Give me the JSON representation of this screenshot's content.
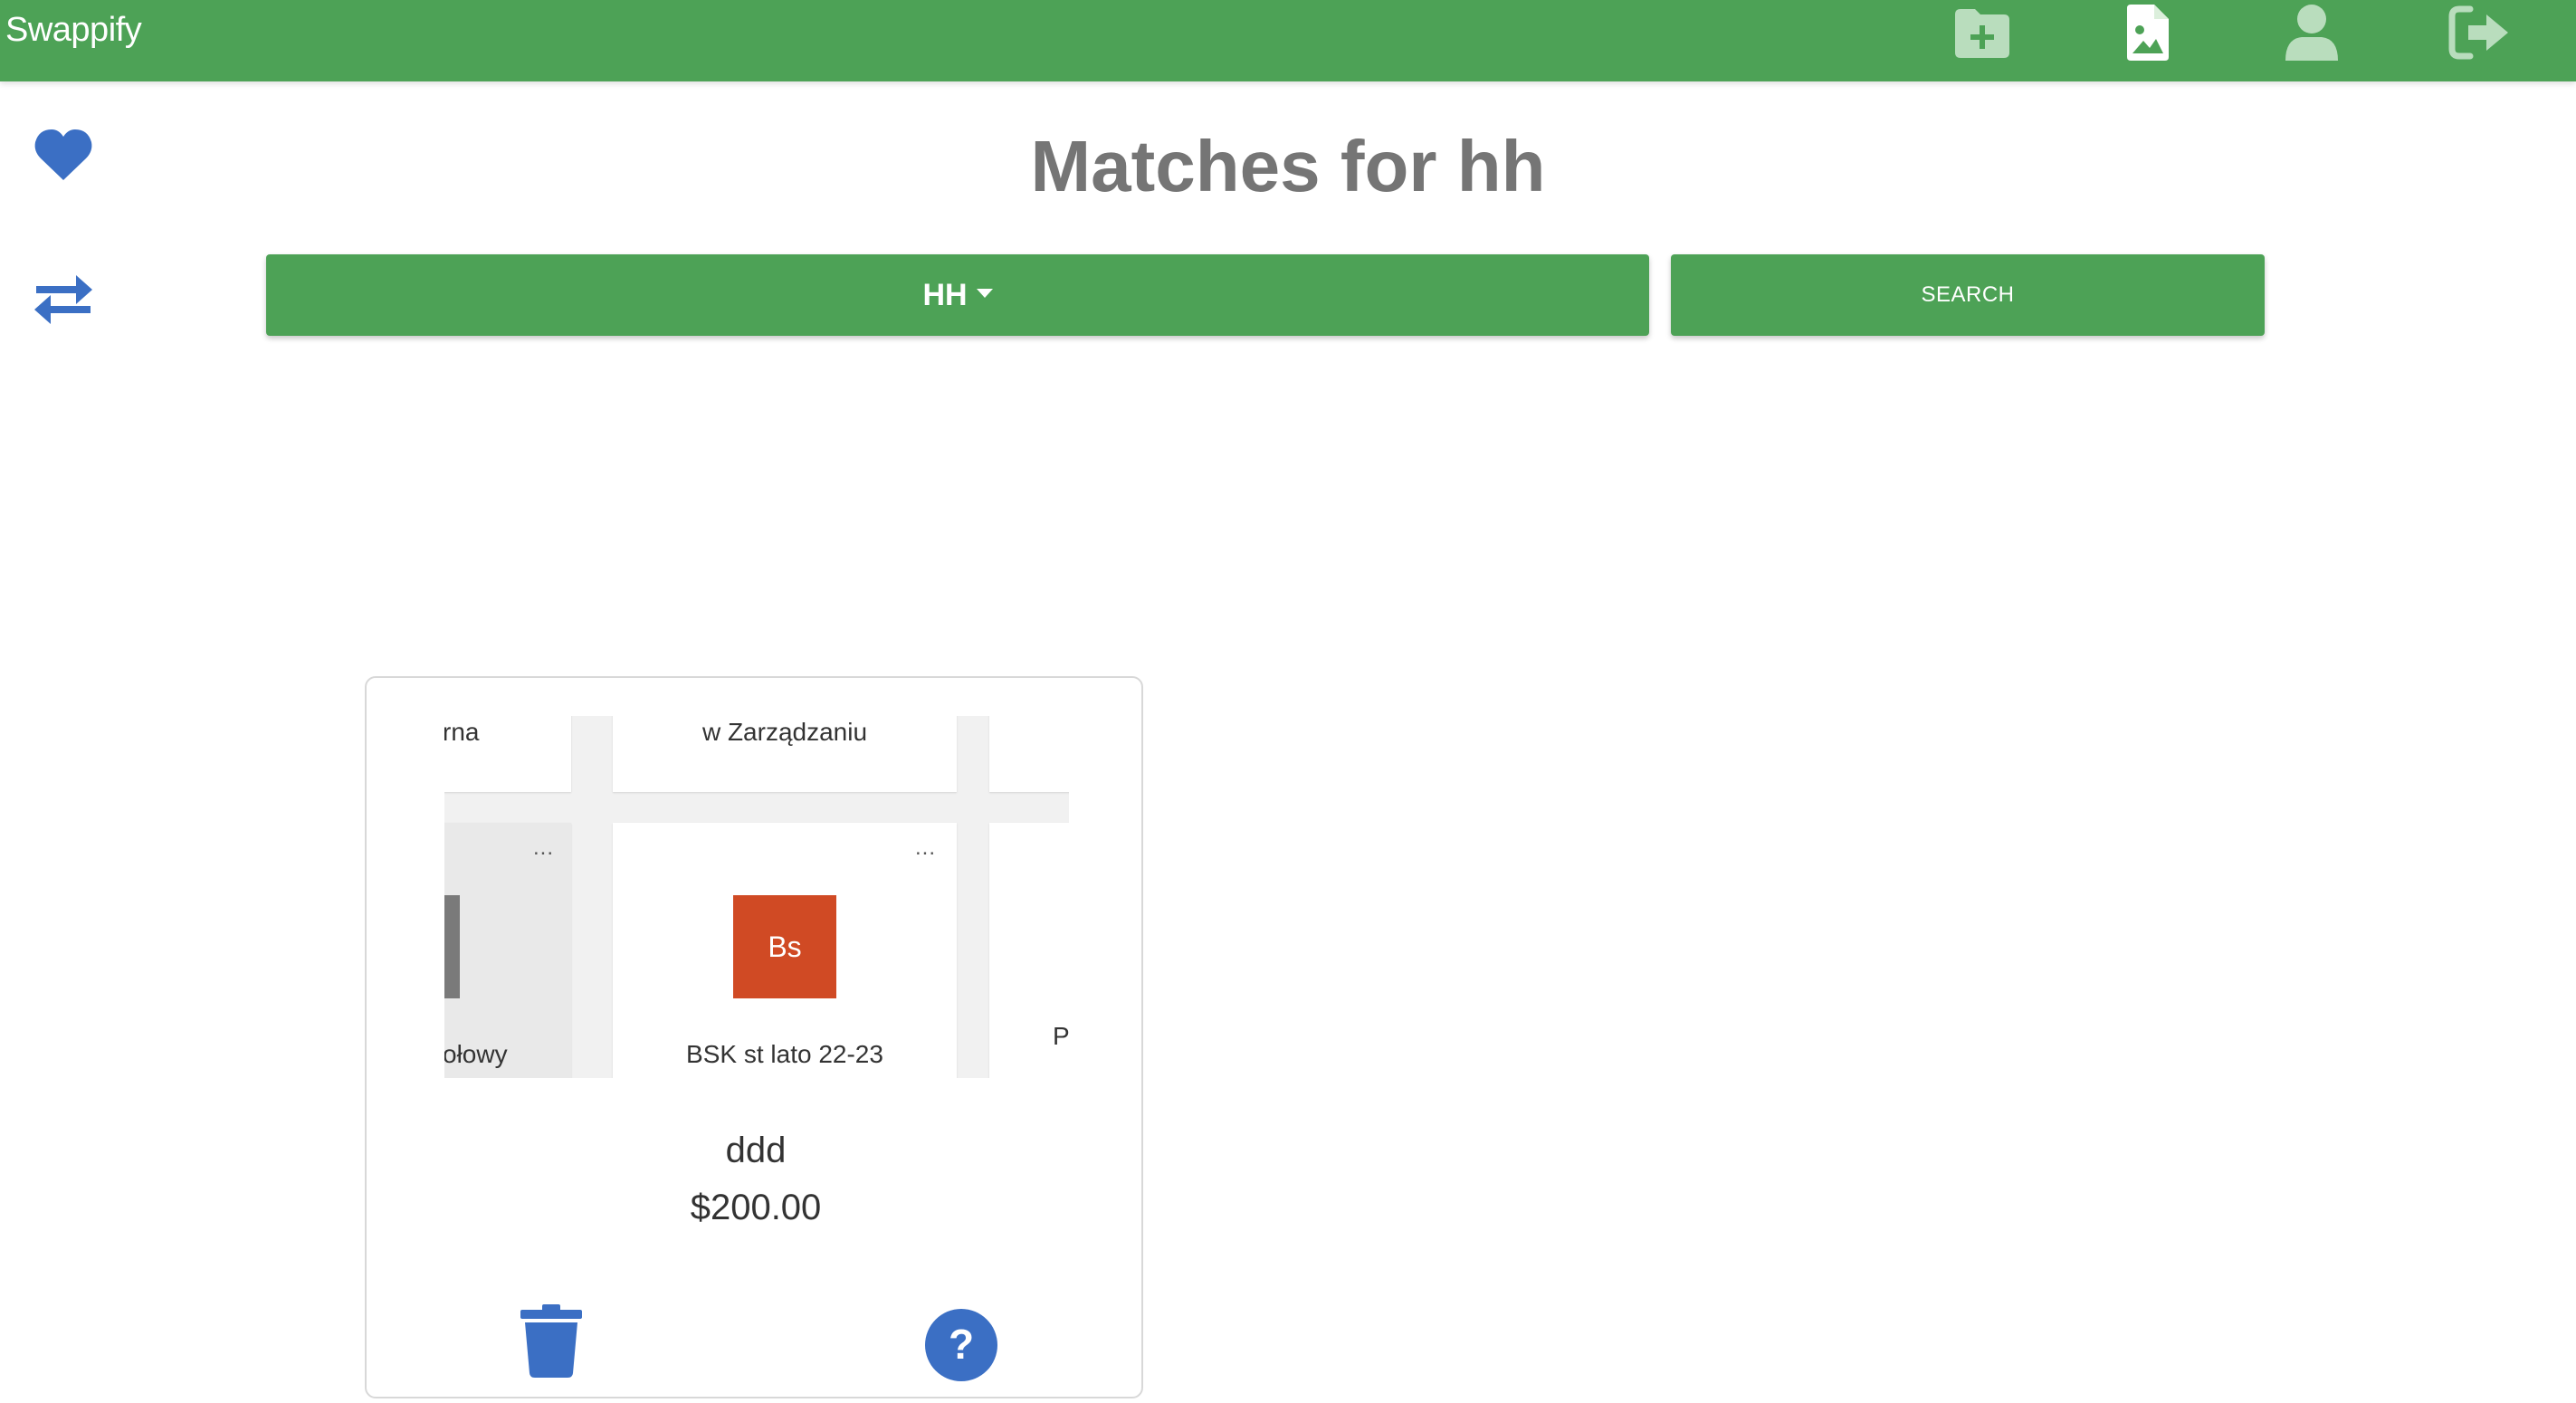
{
  "app": {
    "brand": "Swappify",
    "top_actions": [
      {
        "icon": "folder-plus-icon"
      },
      {
        "icon": "file-image-icon"
      },
      {
        "icon": "user-icon"
      },
      {
        "icon": "sign-out-icon"
      }
    ]
  },
  "sidebar": {
    "items": [
      {
        "icon": "heart-icon",
        "color": "#3b6fc4"
      },
      {
        "icon": "swap-arrows-icon",
        "color": "#3b6fc4"
      }
    ]
  },
  "page": {
    "title": "Matches for hh"
  },
  "toolbar": {
    "dropdown_value": "HH",
    "search_label": "SEARCH"
  },
  "card": {
    "thumbnail": {
      "tile_top_left_text": "rna",
      "tile_top_center_text": "w Zarządzaniu",
      "tile_bottom_left_text": "ołowy",
      "tile_bottom_center_text": "BSK st lato 22-23",
      "tile_bottom_center_badge": "Bs",
      "tile_bottom_right_text": "P",
      "more_dots": "..."
    },
    "title": "ddd",
    "price": "$200.00",
    "actions": [
      {
        "icon": "trash-icon",
        "color": "#3b6fc4"
      },
      {
        "icon": "question-circle-icon",
        "color": "#3b6fc4"
      }
    ]
  },
  "colors": {
    "primary_green": "#4da256",
    "accent_blue": "#3b6fc4",
    "title_grey": "#757575",
    "badge_orange": "#d04a24"
  }
}
